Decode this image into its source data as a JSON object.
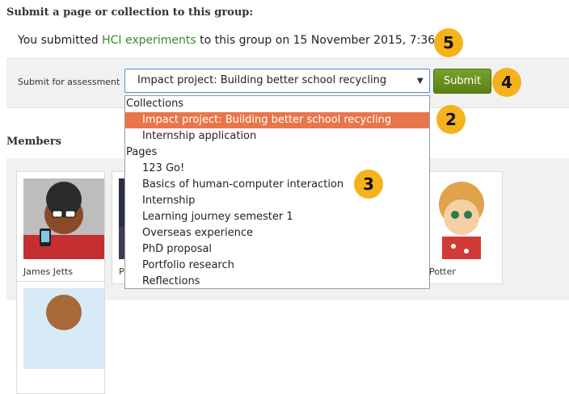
{
  "section": {
    "title": "Submit a page or collection to this group:"
  },
  "submitted": {
    "prefix": "You submitted ",
    "link": "HCI experiments",
    "suffix": " to this group on 15 November 2015, 7:36 PM"
  },
  "assessment": {
    "label": "Submit for assessment",
    "selected": "Impact project: Building better school recycling",
    "submit_label": "Submit"
  },
  "dropdown": {
    "group_collections": "Collections",
    "collections": [
      "Impact project: Building better school recycling",
      "Internship application"
    ],
    "group_pages": "Pages",
    "pages": [
      "123 Go!",
      "Basics of human-computer interaction",
      "Internship",
      "Learning journey semester 1",
      "Overseas experience",
      "PhD proposal",
      "Portfolio research",
      "Reflections"
    ]
  },
  "badges": [
    "5",
    "4",
    "2",
    "3"
  ],
  "members": {
    "title": "Members",
    "people": [
      {
        "name": "James Jetts"
      },
      {
        "name": "P"
      },
      {
        "name": "y Potter"
      }
    ]
  },
  "colors": {
    "link": "#3a8b2e",
    "highlight": "#e8764a",
    "button": "#6a9320",
    "badge": "#f6b21b"
  }
}
